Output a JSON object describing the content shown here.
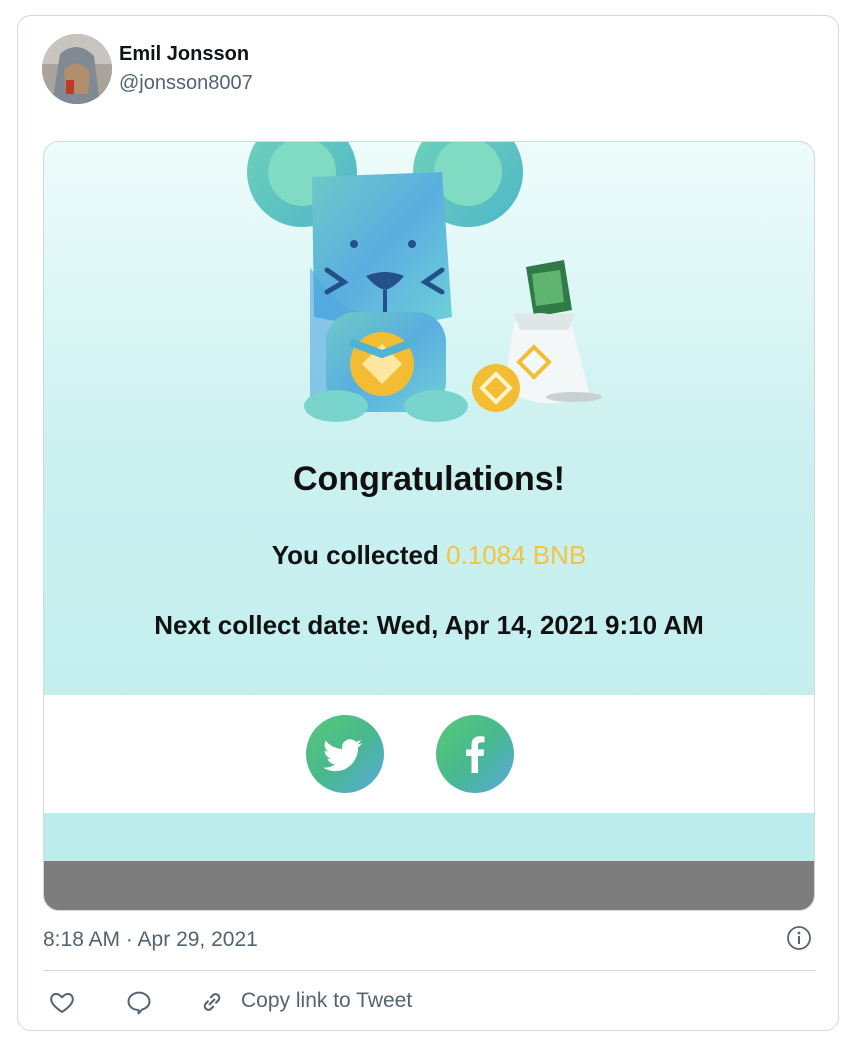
{
  "tweet": {
    "author_name": "Emil Jonsson",
    "author_handle": "@jonsson8007",
    "timestamp": "8:18 AM · Apr 29, 2021"
  },
  "media": {
    "congrats_text": "Congratulations!",
    "collected_prefix": "You collected ",
    "collected_amount": "0.1084 BNB",
    "next_collect": "Next collect date: Wed, Apr 14, 2021 9:10 AM",
    "share_buttons": [
      "twitter",
      "facebook"
    ]
  },
  "actions": {
    "copy_link_label": "Copy link to Tweet"
  },
  "icons": [
    "info-icon",
    "heart-icon",
    "reply-icon",
    "link-icon",
    "twitter-bird-icon",
    "facebook-icon"
  ],
  "colors": {
    "accent_gold": "#f5c242",
    "secondary_text": "#536471",
    "border": "#cfd9de"
  }
}
